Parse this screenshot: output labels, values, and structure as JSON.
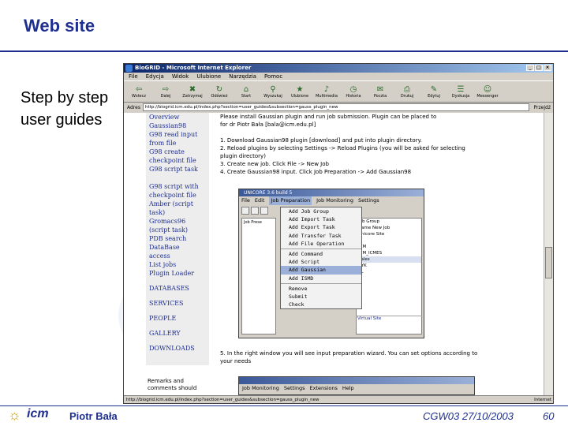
{
  "slide": {
    "title": "Web site",
    "side_text_line1": "Step by step",
    "side_text_line2": "user guides",
    "footer_author": "Piotr Bała",
    "footer_conf": "CGW03 27/10/2003",
    "footer_page": "60"
  },
  "browser": {
    "title": "BioGRID - Microsoft Internet Explorer",
    "menu": [
      "File",
      "Edycja",
      "Widok",
      "Ulubione",
      "Narzędzia",
      "Pomoc"
    ],
    "toolbar": [
      {
        "icon": "back-icon",
        "label": "Wstecz"
      },
      {
        "icon": "forward-icon",
        "label": "Dalej"
      },
      {
        "icon": "stop-icon",
        "label": "Zatrzymaj"
      },
      {
        "icon": "refresh-icon",
        "label": "Odśwież"
      },
      {
        "icon": "home-icon",
        "label": "Start"
      },
      {
        "icon": "search-icon",
        "label": "Wyszukaj"
      },
      {
        "icon": "favorites-icon",
        "label": "Ulubione"
      },
      {
        "icon": "media-icon",
        "label": "Multimedia"
      },
      {
        "icon": "history-icon",
        "label": "Historia"
      },
      {
        "icon": "mail-icon",
        "label": "Poczta"
      },
      {
        "icon": "print-icon",
        "label": "Drukuj"
      },
      {
        "icon": "edit-icon",
        "label": "Edytuj"
      },
      {
        "icon": "discuss-icon",
        "label": "Dyskusja"
      },
      {
        "icon": "messenger-icon",
        "label": "Messenger"
      }
    ],
    "address_label": "Adres",
    "address_value": "http://biogrid.icm.edu.pl/index.php?section=user_guides&subsection=gauss_plugin_new",
    "go_label": "Przejdź",
    "status_text": "http://biogrid.icm.edu.pl/index.php?section=user_guides&subsection=gauss_plugin_new",
    "status_zone": "Internet"
  },
  "nav": {
    "items": [
      "Overview",
      "Gaussian98",
      "G98 read input",
      "from file",
      "G98 create",
      "checkpoint file",
      "G98 script task",
      "",
      "G98 script with",
      "checkpoint file",
      "Amber (script",
      "task)",
      "Gromacs96",
      "(script task)",
      "PDB search",
      "DataBase",
      "access",
      "List jobs",
      "Plugin Loader"
    ],
    "heads": [
      "DATABASES",
      "SERVICES",
      "PEOPLE",
      "GALLERY",
      "DOWNLOADS"
    ]
  },
  "page": {
    "lines": [
      "Please install Gaussian plugin and run job submission. Plugin can be placed to",
      "for dr Piotr Bała [bala@icm.edu.pl]",
      "",
      "1.  Download Gaussian98 plugin [download] and put into plugin directory.",
      "2.  Reload plugins by selecting Settings -> Reload Plugins (you will be asked for selecting",
      "     plugin directory)",
      "3.  Create new job. Click File -> New Job",
      "4.  Create Gaussian98 input. Click Job Preparation -> Add Gaussian98"
    ],
    "step5_line1": "5.  In the right window you will see input preparation wizard. You can set options according to",
    "step5_line2": "     your needs",
    "remarks_line1": "Remarks and",
    "remarks_line2": "comments should"
  },
  "unicore": {
    "title": "UNICORE 3.6 build 5",
    "menu": [
      "File",
      "Edit",
      "Job Preparation",
      "Job Monitoring",
      "Settings"
    ],
    "dropdown": [
      "Add Job Group",
      "Add Import Task",
      "Add Export Task",
      "Add Transfer Task",
      "Add File Operation",
      "",
      "Add Command",
      "Add Script",
      "Add Gaussian",
      "Add ISMD",
      "",
      "Remove",
      "Submit",
      "Check"
    ],
    "selected_item": "Add Gaussian",
    "right_panel": [
      "Job Group",
      "Name  New Job",
      "Unicore Site",
      "",
      "ICM",
      "ICM_ICMES",
      "Sales",
      "ZYK",
      "PL"
    ],
    "tree_label": "Job Prese",
    "virtual_site": "Virtual Site"
  },
  "second_app": {
    "menu": [
      "Job Monitoring",
      "Settings",
      "Extensions",
      "Help"
    ]
  }
}
